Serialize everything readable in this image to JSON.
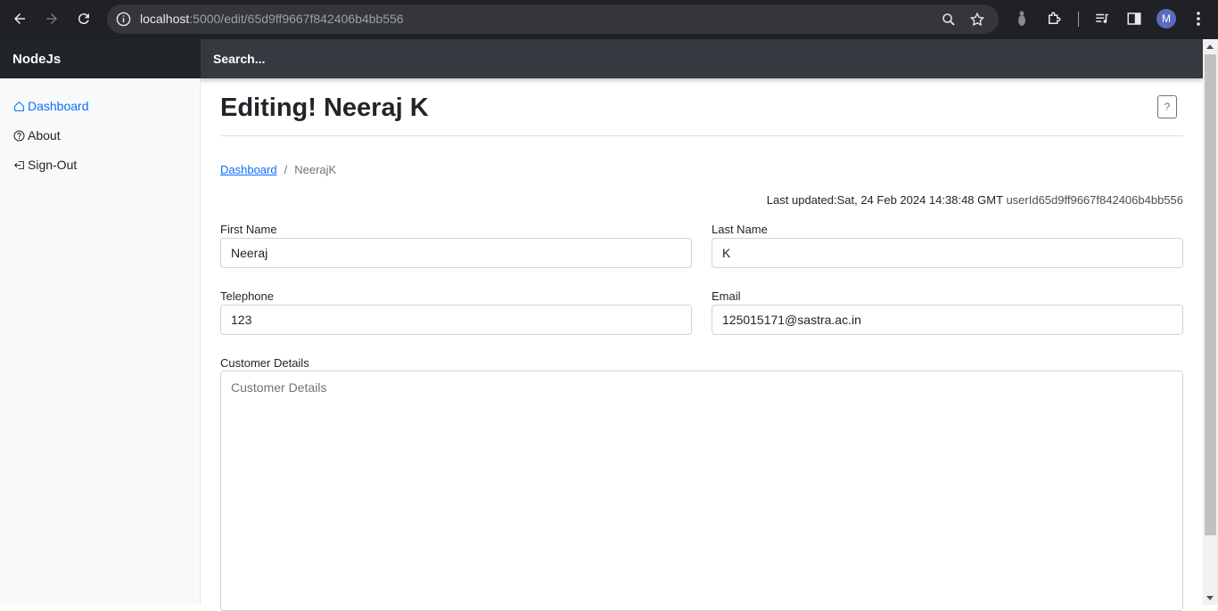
{
  "browser": {
    "url_host": "localhost",
    "url_rest": ":5000/edit/65d9ff9667f842406b4bb556",
    "profile_initial": "M"
  },
  "navbar": {
    "brand": "NodeJs",
    "search_label": "Search..."
  },
  "sidebar": {
    "items": [
      {
        "label": "Dashboard",
        "icon": "home-icon",
        "active": true
      },
      {
        "label": "About",
        "icon": "question-circle-icon",
        "active": false
      },
      {
        "label": "Sign-Out",
        "icon": "sign-out-icon",
        "active": false
      }
    ]
  },
  "main": {
    "title": "Editing! Neeraj K",
    "help_label": "?",
    "breadcrumb": {
      "link": "Dashboard",
      "separator": "/",
      "current": "NeerajK"
    },
    "meta": {
      "last_updated": "Last updated:Sat, 24 Feb 2024 14:38:48 GMT",
      "user_id": "userId65d9ff9667f842406b4bb556"
    },
    "form": {
      "first_name_label": "First Name",
      "first_name_value": "Neeraj",
      "last_name_label": "Last Name",
      "last_name_value": "K",
      "telephone_label": "Telephone",
      "telephone_value": "123",
      "email_label": "Email",
      "email_value": "125015171@sastra.ac.in",
      "details_label": "Customer Details",
      "details_placeholder": "Customer Details"
    }
  },
  "colors": {
    "accent": "#0d6efd",
    "navbar_bg": "#343a40",
    "brand_bg": "#212529",
    "chrome_bg": "#202124"
  }
}
